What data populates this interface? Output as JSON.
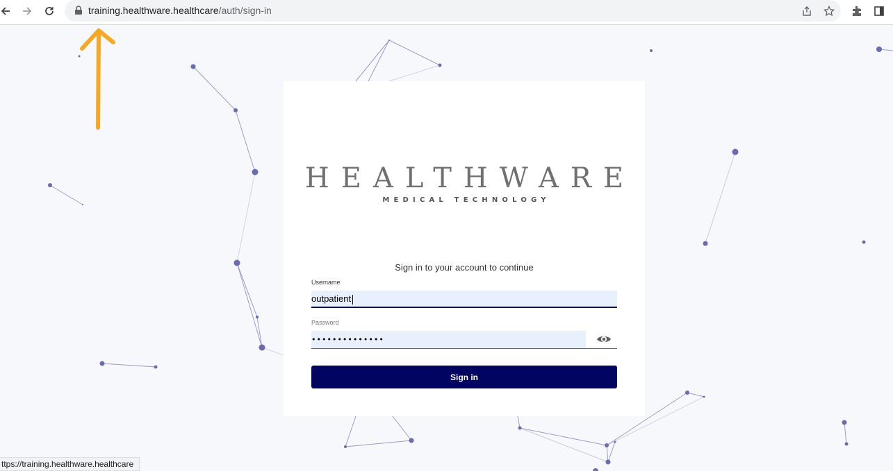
{
  "browser": {
    "url_host": "training.healthware.healthcare",
    "url_path": "/auth/sign-in",
    "status_url": "ttps://training.healthware.healthcare"
  },
  "logo": {
    "main": "HEALTHWARE",
    "sub": "MEDICAL TECHNOLOGY"
  },
  "form": {
    "subtitle": "Sign in to your account to continue",
    "username_label": "Username",
    "username_value": "outpatient",
    "password_label": "Password",
    "password_value": "••••••••••••••",
    "signin_label": "Sign in"
  },
  "colors": {
    "accent": "#020462",
    "node": "#6b6bb0",
    "arrow": "#f7a823"
  },
  "icons": [
    "back-icon",
    "forward-icon",
    "reload-icon",
    "lock-icon",
    "share-icon",
    "star-icon",
    "extensions-icon",
    "side-panel-icon",
    "eye-icon"
  ]
}
